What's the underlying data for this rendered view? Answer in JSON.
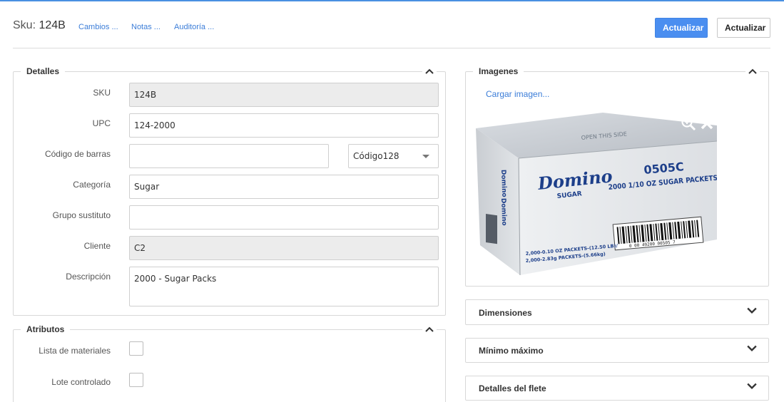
{
  "header": {
    "sku_prefix": "Sku:",
    "sku_value": "124B",
    "links": [
      "Cambios ...",
      "Notas ...",
      "Auditoría ..."
    ],
    "primary_button": "Actualizar",
    "secondary_button": "Actualizar"
  },
  "details": {
    "title": "Detalles",
    "fields": {
      "sku": {
        "label": "SKU",
        "value": "124B"
      },
      "upc": {
        "label": "UPC",
        "value": "124-2000"
      },
      "barcode": {
        "label": "Código de barras",
        "value": "",
        "type_value": "Código128"
      },
      "category": {
        "label": "Categoría",
        "value": "Sugar"
      },
      "substitute_group": {
        "label": "Grupo sustituto",
        "value": ""
      },
      "client": {
        "label": "Cliente",
        "value": "C2"
      },
      "description": {
        "label": "Descripción",
        "value": "2000 - Sugar Packs"
      }
    }
  },
  "attributes": {
    "title": "Atributos",
    "items": [
      {
        "label": "Lista de materiales",
        "checked": false
      },
      {
        "label": "Lote controlado",
        "checked": false
      }
    ]
  },
  "images": {
    "title": "Imagenes",
    "upload_link": "Cargar imagen...",
    "photo": {
      "brand": "Domino",
      "brand_sub": "SUGAR",
      "code": "0505C",
      "product_line": "2000 1/10 OZ SUGAR PACKETS",
      "top_flap": "OPEN THIS SIDE",
      "weight_line_1": "2,000-0.10 OZ PACKETS-(12.50 LB)/",
      "weight_line_2": "2,000-2.83g PACKETS-(5.66kg)",
      "barcode_digits": "0 00 49200 00505 7"
    }
  },
  "collapsed_sections": [
    "Dimensiones",
    "Mínimo máximo",
    "Detalles del flete"
  ],
  "colors": {
    "accent": "#4a8ef0",
    "link": "#3b7dd8",
    "border": "#d8d8d8",
    "readonly_bg": "#ececec"
  }
}
